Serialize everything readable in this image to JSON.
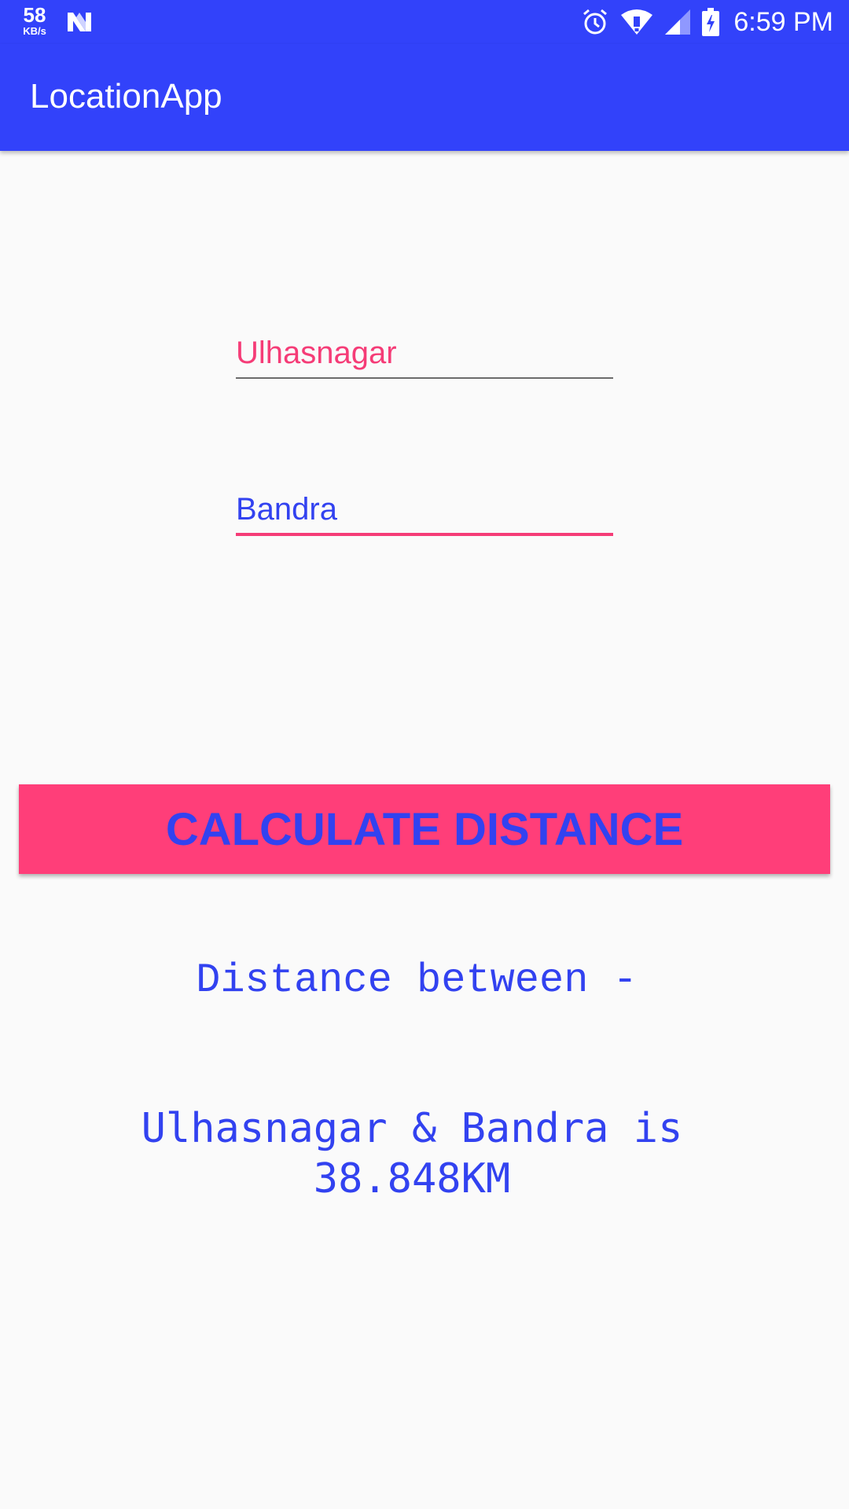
{
  "status_bar": {
    "net_speed_value": "58",
    "net_speed_unit": "KB/s",
    "time": "6:59 PM",
    "icons": [
      "n-notification-icon",
      "alarm-icon",
      "wifi-icon",
      "cell-signal-icon",
      "battery-icon"
    ]
  },
  "app_bar": {
    "title": "LocationApp"
  },
  "form": {
    "source_value": "Ulhasnagar",
    "destination_value": "Bandra",
    "calculate_label": "CALCULATE DISTANCE"
  },
  "result": {
    "heading": "Distance between -",
    "line1": "Ulhasnagar & Bandra is",
    "line2": "38.848KM"
  },
  "colors": {
    "primary": "#3242fa",
    "accent": "#ff3e79",
    "text_blue": "#3242f0",
    "background": "#fafafa"
  }
}
